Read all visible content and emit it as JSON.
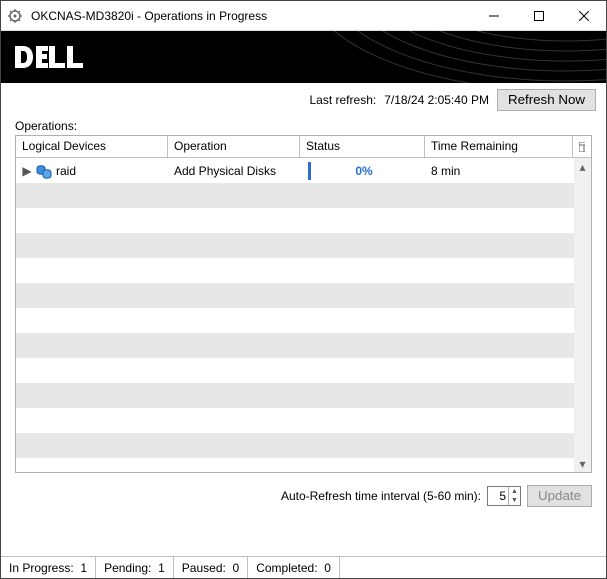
{
  "window": {
    "title": "OKCNAS-MD3820i - Operations in Progress"
  },
  "refresh": {
    "last_label": "Last refresh:",
    "last_value": "7/18/24 2:05:40 PM",
    "button": "Refresh Now"
  },
  "operations_label": "Operations:",
  "columns": {
    "logical_devices": "Logical Devices",
    "operation": "Operation",
    "status": "Status",
    "time_remaining": "Time Remaining"
  },
  "rows": [
    {
      "name": "raid",
      "operation": "Add Physical Disks",
      "status_pct": "0%",
      "time_remaining": "8 min"
    }
  ],
  "auto_refresh": {
    "label": "Auto-Refresh time interval (5-60 min):",
    "value": "5",
    "update_button": "Update"
  },
  "status": {
    "in_progress_label": "In Progress:",
    "in_progress_value": "1",
    "pending_label": "Pending:",
    "pending_value": "1",
    "paused_label": "Paused:",
    "paused_value": "0",
    "completed_label": "Completed:",
    "completed_value": "0"
  }
}
